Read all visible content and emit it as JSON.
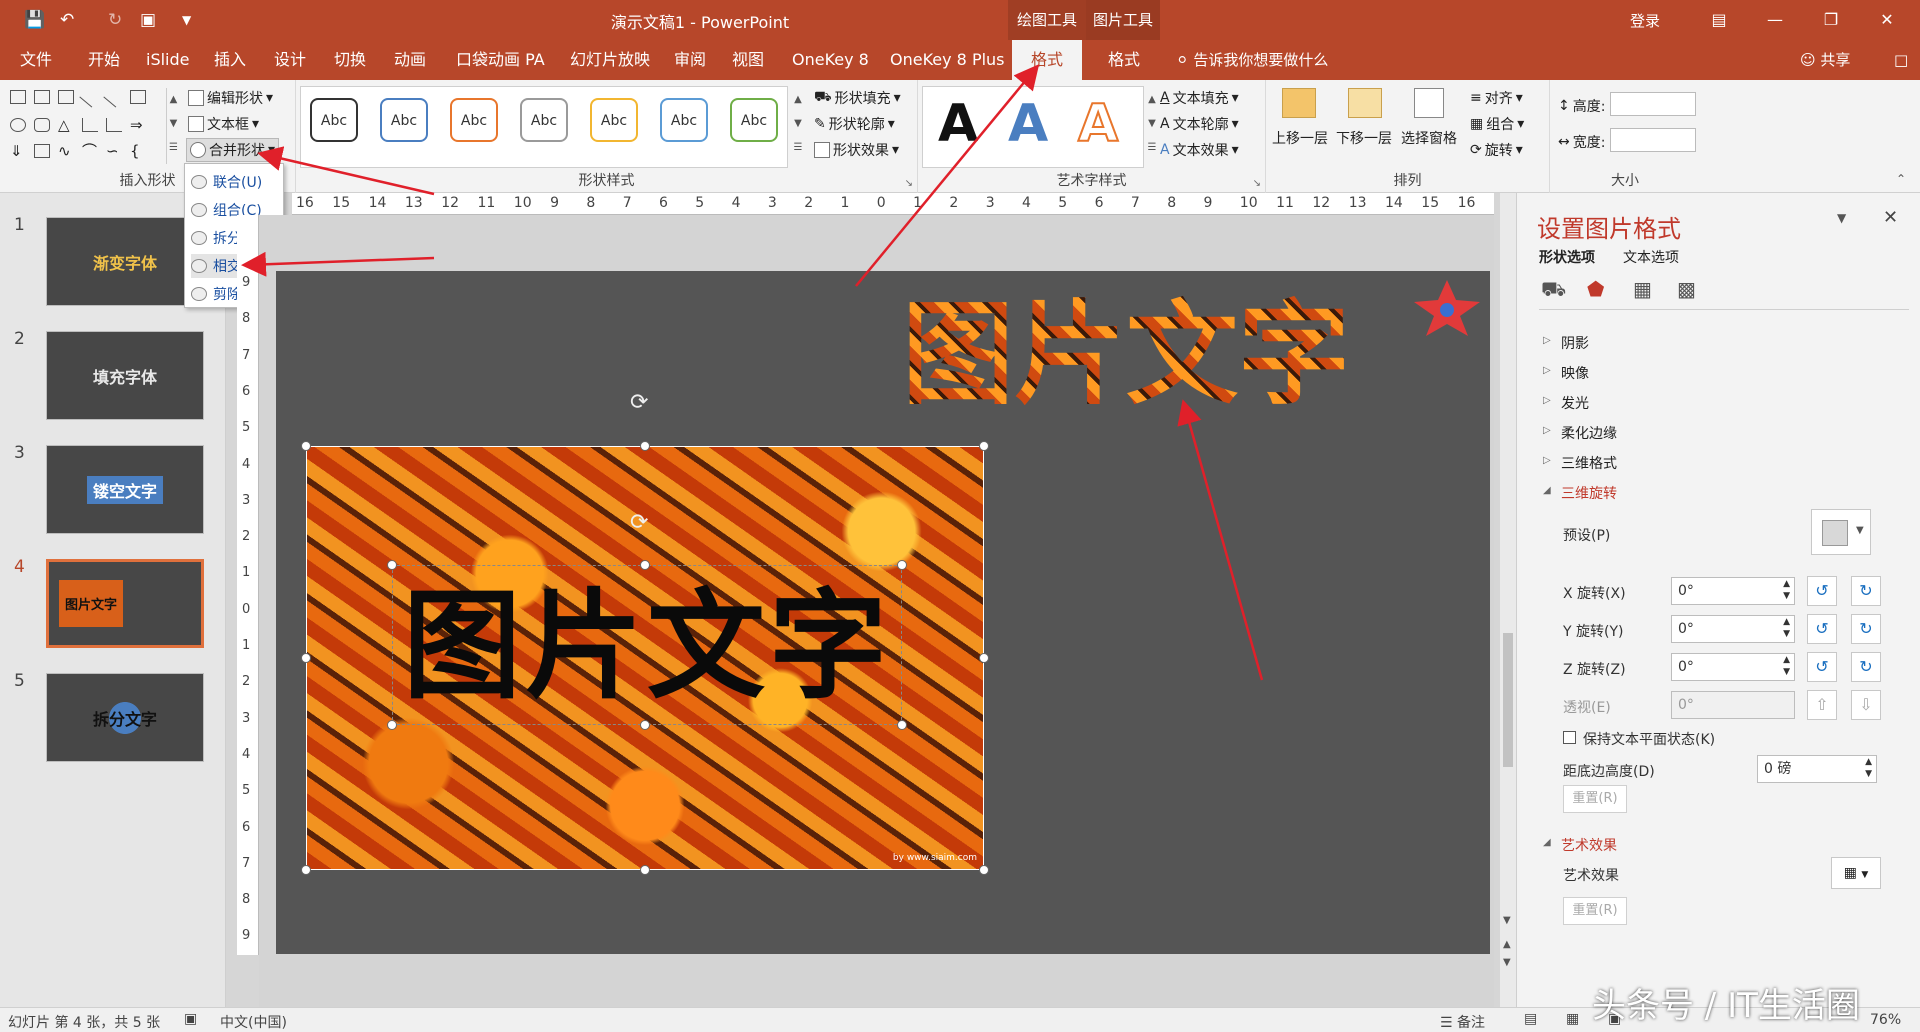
{
  "window": {
    "title": "演示文稿1 - PowerPoint",
    "login": "登录"
  },
  "context_groups": [
    {
      "label": "绘图工具",
      "tab": "格式",
      "active": true
    },
    {
      "label": "图片工具",
      "tab": "格式",
      "active": false
    }
  ],
  "tabs": [
    "文件",
    "开始",
    "iSlide",
    "插入",
    "设计",
    "切换",
    "动画",
    "口袋动画 PA",
    "幻灯片放映",
    "审阅",
    "视图",
    "OneKey 8",
    "OneKey 8 Plus"
  ],
  "tell_me": "告诉我你想要做什么",
  "share": "共享",
  "ribbon": {
    "insert_shapes": {
      "label": "插入形状",
      "edit_shape": "编辑形状",
      "text_box": "文本框",
      "merge_shapes": "合并形状"
    },
    "shape_styles": {
      "label": "形状样式",
      "sample": "Abc",
      "fill": "形状填充",
      "outline": "形状轮廓",
      "effects": "形状效果",
      "swatches": [
        "#333333",
        "#4a7ec0",
        "#e8762c",
        "#9a9a9a",
        "#f2b630",
        "#5b9bd5",
        "#6fae47"
      ]
    },
    "wordart": {
      "label": "艺术字样式",
      "letter": "A",
      "fill": "文本填充",
      "outline": "文本轮廓",
      "effects": "文本效果"
    },
    "arrange": {
      "label": "排列",
      "forward": "上移一层",
      "backward": "下移一层",
      "pane": "选择窗格",
      "align": "对齐",
      "group": "组合",
      "rotate": "旋转"
    },
    "size": {
      "label": "大小",
      "height": "高度:",
      "width": "宽度:"
    }
  },
  "merge_menu": [
    {
      "label": "联合(U)"
    },
    {
      "label": "组合(C)"
    },
    {
      "label": "拆分(F)"
    },
    {
      "label": "相交(I)"
    },
    {
      "label": "剪除(S)"
    }
  ],
  "slides": [
    {
      "num": "1",
      "text": "渐变字体",
      "color": "#f0c24a"
    },
    {
      "num": "2",
      "text": "填充字体",
      "color": "#e8e8e8"
    },
    {
      "num": "3",
      "text": "镂空文字",
      "color": "#ffffff"
    },
    {
      "num": "4",
      "text": "图片文字",
      "color": "#111111",
      "selected": true
    },
    {
      "num": "5",
      "text": "拆分文字",
      "color": "#111111"
    }
  ],
  "slide_content": {
    "photo_text": "图片文字",
    "hollow_text": "图片文字",
    "watermark": "by www.siaim.com"
  },
  "hruler_ticks": [
    "16",
    "15",
    "14",
    "13",
    "12",
    "11",
    "10",
    "9",
    "8",
    "7",
    "6",
    "5",
    "4",
    "3",
    "2",
    "1",
    "0",
    "1",
    "2",
    "3",
    "4",
    "5",
    "6",
    "7",
    "8",
    "9",
    "10",
    "11",
    "12",
    "13",
    "14",
    "15",
    "16"
  ],
  "vruler_ticks": [
    "9",
    "8",
    "7",
    "6",
    "5",
    "4",
    "3",
    "2",
    "1",
    "0",
    "1",
    "2",
    "3",
    "4",
    "5",
    "6",
    "7",
    "8",
    "9"
  ],
  "pane": {
    "title": "设置图片格式",
    "tabs": [
      "形状选项",
      "文本选项"
    ],
    "sections": [
      "阴影",
      "映像",
      "发光",
      "柔化边缘",
      "三维格式"
    ],
    "rotation_section": "三维旋转",
    "preset": "预设(P)",
    "x_label": "X 旋转(X)",
    "x_value": "0°",
    "y_label": "Y 旋转(Y)",
    "y_value": "0°",
    "z_label": "Z 旋转(Z)",
    "z_value": "0°",
    "persp_label": "透视(E)",
    "persp_value": "0°",
    "keep_flat": "保持文本平面状态(K)",
    "distance_label": "距底边高度(D)",
    "distance_value": "0 磅",
    "reset": "重置(R)",
    "art_section": "艺术效果",
    "art_label": "艺术效果",
    "accent": "#c0392b"
  },
  "status": {
    "slide_info": "幻灯片 第 4 张，共 5 张",
    "lang": "中文(中国)",
    "notes": "备注",
    "zoom": "76%"
  },
  "watermark_brand": "头条号 / IT生活圈",
  "theme": {
    "accent": "#b7472a"
  }
}
